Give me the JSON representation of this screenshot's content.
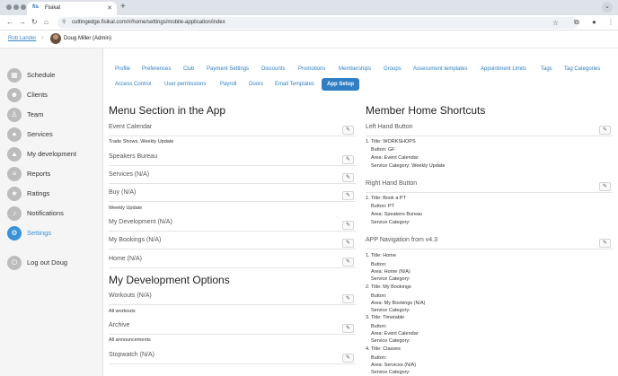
{
  "browser": {
    "tab_title": "Fisikal",
    "favicon": "fis",
    "url": "cuttingedge.fisikal.com/#/home/settings/mobile-application/index"
  },
  "breadcrumb": {
    "link": "Rob Lander",
    "user": "Doug Miller (Admin)"
  },
  "sidebar": {
    "items": [
      {
        "label": "Schedule",
        "icon": "calendar-icon"
      },
      {
        "label": "Clients",
        "icon": "clients-icon"
      },
      {
        "label": "Team",
        "icon": "team-icon"
      },
      {
        "label": "Services",
        "icon": "services-icon"
      },
      {
        "label": "My development",
        "icon": "development-icon"
      },
      {
        "label": "Reports",
        "icon": "reports-icon"
      },
      {
        "label": "Ratings",
        "icon": "star-icon"
      },
      {
        "label": "Notifications",
        "icon": "bell-icon"
      },
      {
        "label": "Settings",
        "icon": "gear-icon"
      },
      {
        "label": "Log out Doug",
        "icon": "logout-icon"
      }
    ],
    "active_index": 8
  },
  "nav_tabs": {
    "row1": [
      "Profile",
      "Preferences",
      "Club",
      "Payment Settings",
      "Discounts",
      "Promotions",
      "Memberships",
      "Groups",
      "Assessment templates",
      "Appointment Limits",
      "Tags",
      "Tag Categories"
    ],
    "row2": [
      "Access Control",
      "User permissions",
      "Payroll",
      "Doors",
      "Email Templates",
      "App Setup"
    ],
    "active": "App Setup"
  },
  "menu_section": {
    "title": "Menu Section in the App",
    "rows": [
      {
        "label": "Event Calendar",
        "sub": "Trade Shows, Weekly Update"
      },
      {
        "label": "Speakers Bureau",
        "sub": ""
      },
      {
        "label": "Services (N/A)",
        "sub": ""
      },
      {
        "label": "Buy (N/A)",
        "sub": "Weekly Update"
      },
      {
        "label": "My Development (N/A)",
        "sub": ""
      },
      {
        "label": "My Bookings (N/A)",
        "sub": ""
      },
      {
        "label": "Home (N/A)",
        "sub": ""
      }
    ]
  },
  "dev_options": {
    "title": "My Development Options",
    "rows": [
      {
        "label": "Workouts (N/A)",
        "sub": "All workouts"
      },
      {
        "label": "Archive",
        "sub": "All announcements"
      },
      {
        "label": "Stopwatch (N/A)",
        "sub": ""
      }
    ]
  },
  "shortcuts": {
    "title": "Member Home Shortcuts",
    "left": {
      "label": "Left Hand Button",
      "lines": [
        "1. Title: WORKSHOPS",
        "Button: GF",
        "Area: Event Calendar",
        "Service Category: Weekly Update"
      ]
    },
    "right": {
      "label": "Right Hand Button",
      "lines": [
        "1. Title: Book a PT",
        "Button: PT",
        "Area: Speakers Bureau",
        "Service Category:"
      ]
    },
    "nav": {
      "label": "APP Navigation from v4.3",
      "lines": [
        "1. Title: Home",
        "Button:",
        "Area: Home (N/A)",
        "Service Category:",
        "2. Title: My Bookings",
        "Button:",
        "Area: My Bookings (N/A)",
        "Service Category:",
        "3. Title: Timetable",
        "Button:",
        "Area: Event Calendar",
        "Service Category:",
        "4. Title: Classes",
        "Button:",
        "Area: Services (N/A)",
        "Service Category:"
      ]
    }
  },
  "colors": {
    "accent": "#2e7fc4",
    "link": "#2d7fc1",
    "sidebar_bg": "#f5f5f5"
  }
}
